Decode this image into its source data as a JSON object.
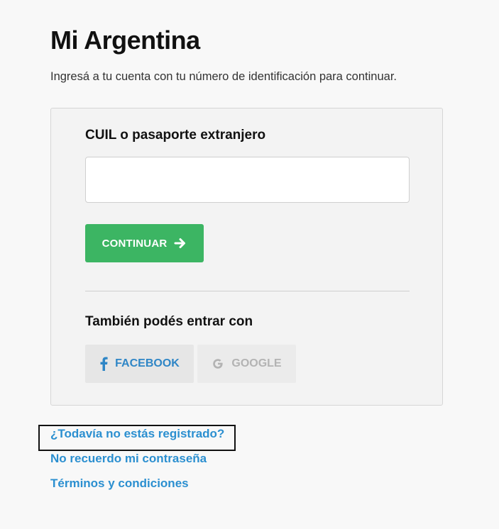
{
  "page": {
    "title": "Mi Argentina",
    "subtitle": "Ingresá a tu cuenta con tu número de identificación para continuar."
  },
  "login_form": {
    "field_label": "CUIL o pasaporte extranjero",
    "input_value": "",
    "input_placeholder": "",
    "continue_label": "CONTINUAR",
    "continue_icon": "arrow-right-icon",
    "alt_login_label": "También podés entrar con",
    "facebook_label": "FACEBOOK",
    "facebook_icon": "facebook-icon",
    "google_label": "GOOGLE",
    "google_icon": "google-icon"
  },
  "links": {
    "register": "¿Todavía no estás registrado?",
    "forgot_password": "No recuerdo mi contraseña",
    "terms": "Términos y condiciones"
  },
  "colors": {
    "primary_button": "#3cb563",
    "link": "#2b8fd0",
    "facebook_text": "#2f86c6",
    "google_text_disabled": "#b3b3b3"
  }
}
